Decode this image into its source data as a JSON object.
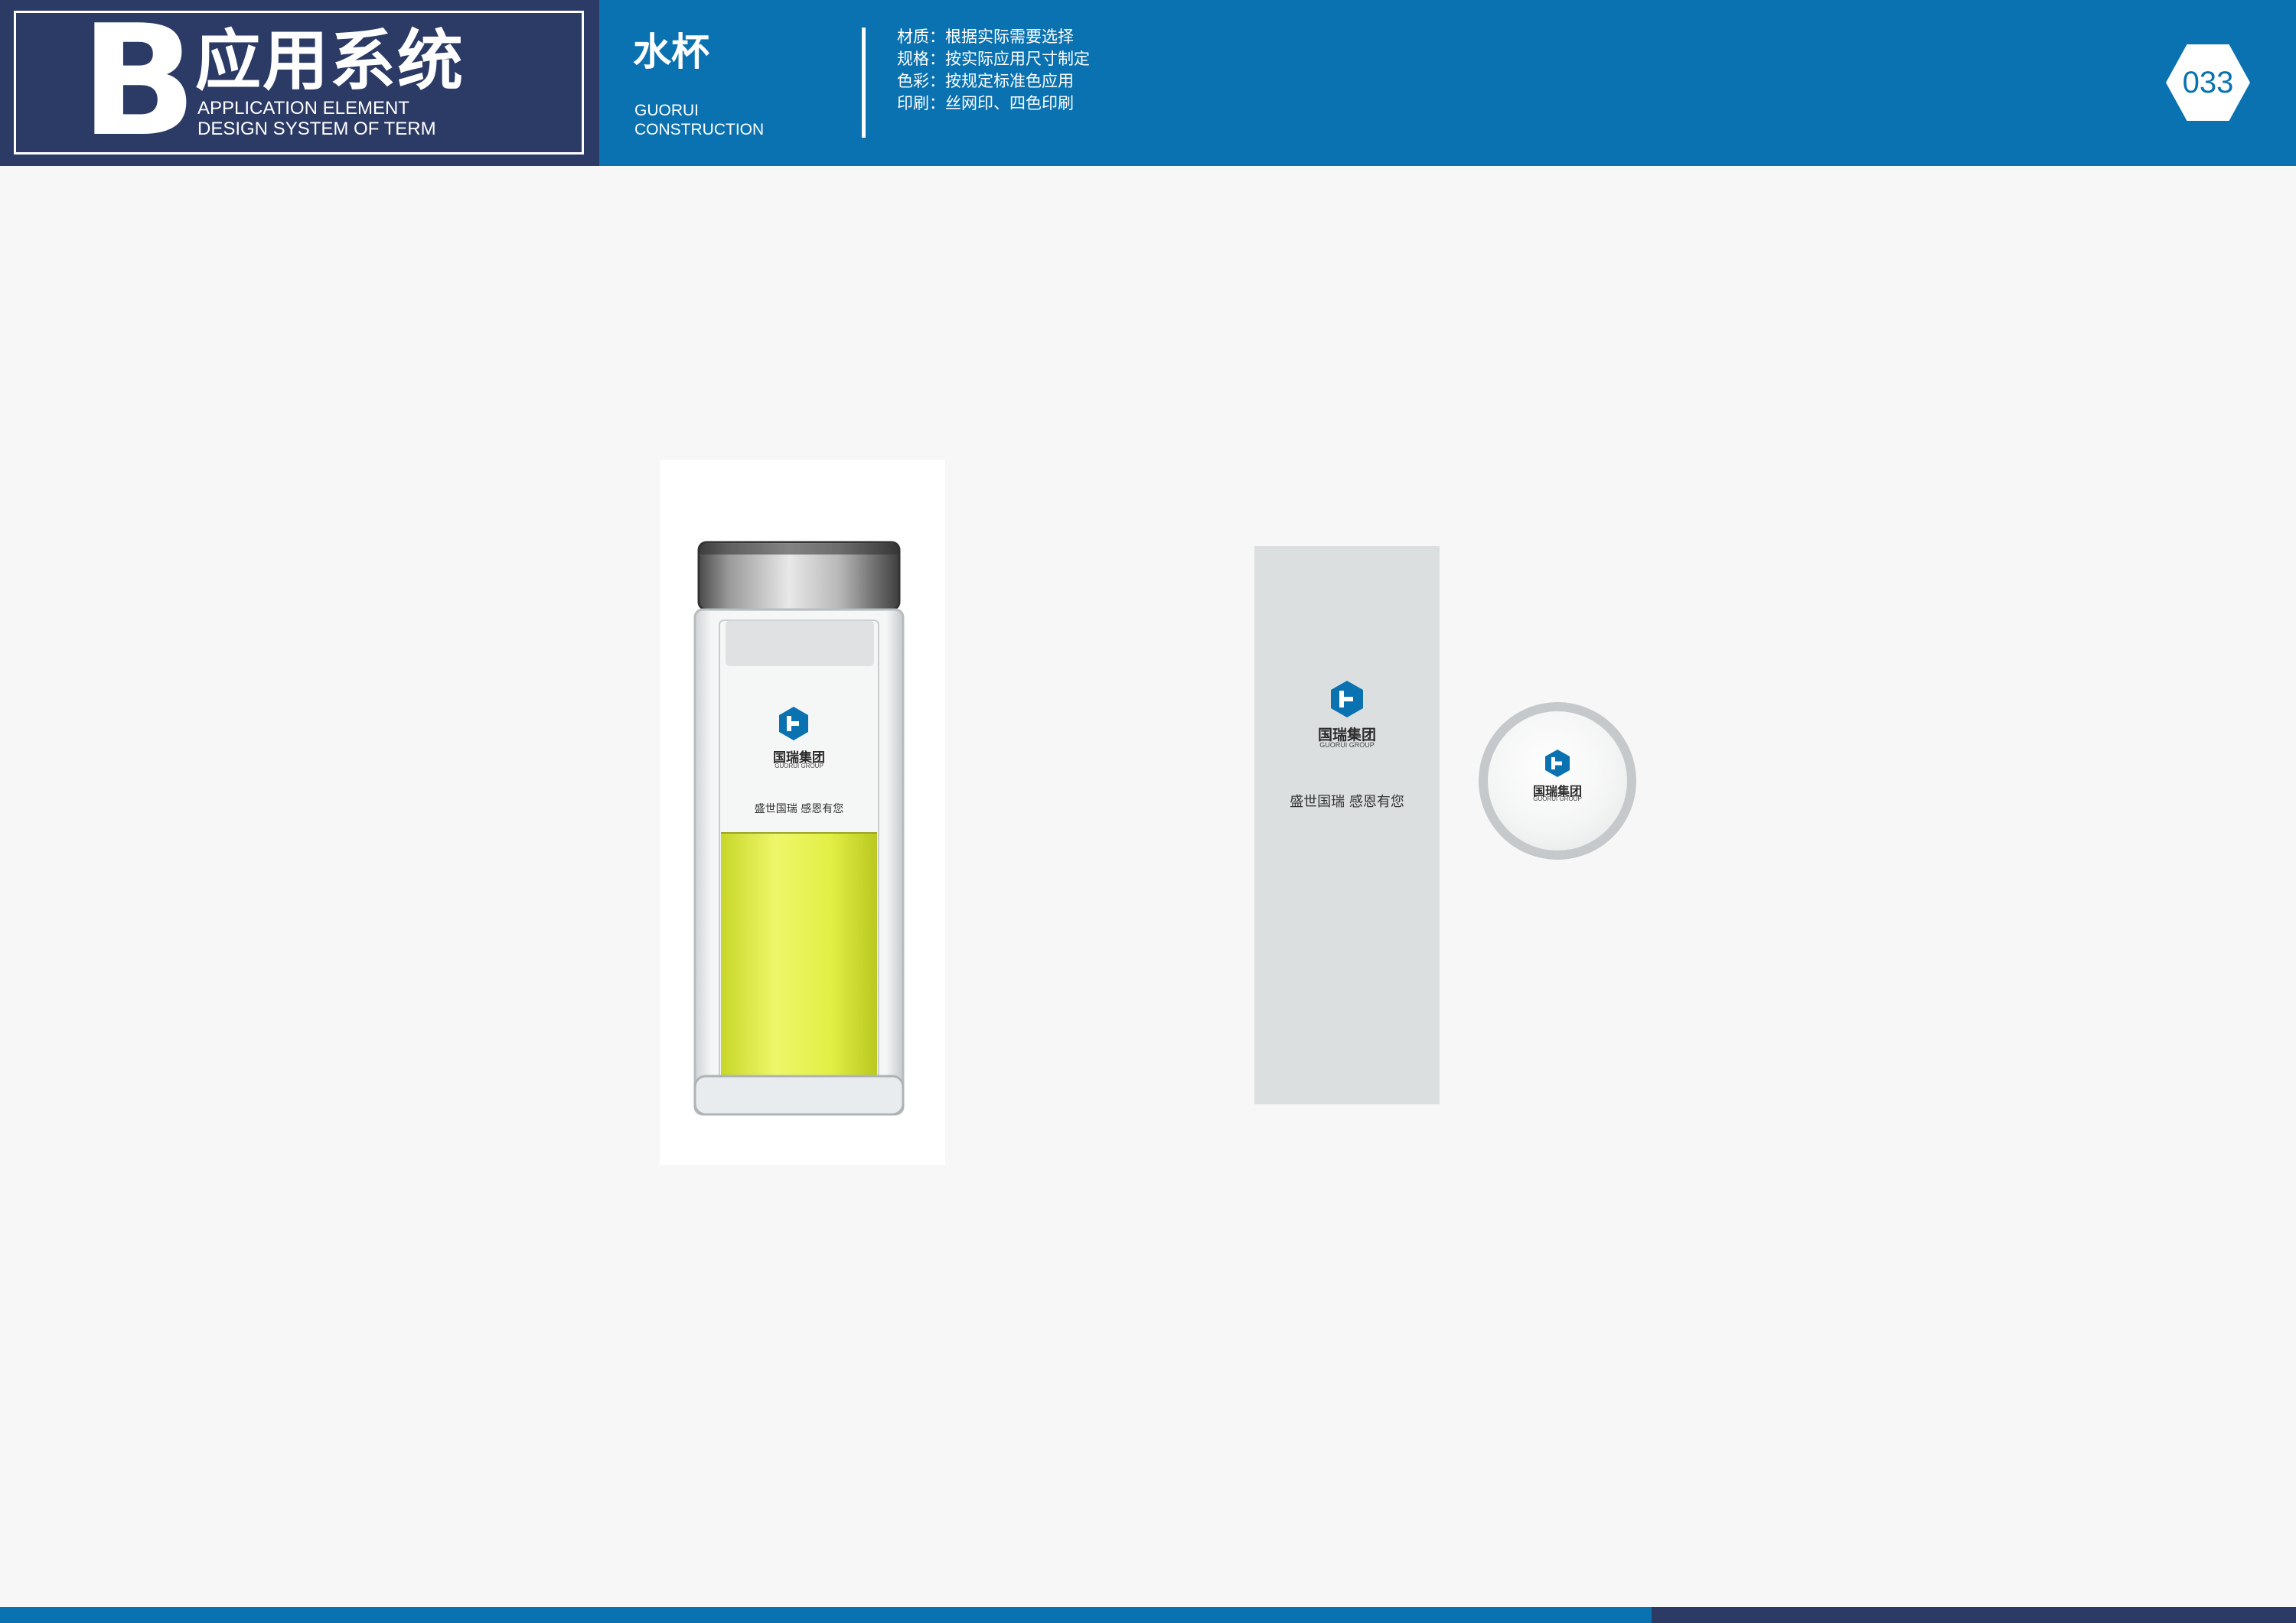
{
  "header": {
    "brand_letter": "B",
    "brand_title": "应用系统",
    "brand_subtitle_line1": "APPLICATION ELEMENT",
    "brand_subtitle_line2": "DESIGN SYSTEM OF TERM",
    "section_title": "水杯",
    "section_subtitle_line1": "GUORUI",
    "section_subtitle_line2": "CONSTRUCTION",
    "specs": [
      "材质：根据实际需要选择",
      "规格：按实际应用尺寸制定",
      "色彩：按规定标准色应用",
      "印刷：丝网印、四色印刷"
    ],
    "page_number": "033"
  },
  "logo": {
    "name_cn": "国瑞集团",
    "name_en": "GUORUI GROUP",
    "slogan": "盛世国瑞 感恩有您"
  },
  "colors": {
    "header_blue": "#0a72b0",
    "navy": "#2c3a66",
    "tea_yellow": "#e6f25a",
    "mockup_gray": "#dcdfe0"
  }
}
